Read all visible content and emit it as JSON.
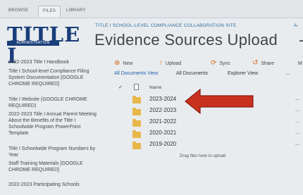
{
  "ribbon": {
    "tabs": [
      "BROWSE",
      "FILES",
      "LIBRARY"
    ]
  },
  "logo": {
    "text": "TITLE I",
    "subtext": "ADMINISTRATION"
  },
  "site": {
    "title": "TITLE I SCHOOL-LEVEL COMPLIANCE COLLABORATION SITE",
    "title_extra": "A-"
  },
  "page": {
    "title": "Evidence Sources Upload",
    "title_extra": "-"
  },
  "nav": {
    "items": [
      "2022-2023 Title I Handbook",
      "Title I School-level Compliance Filing System Documentation [GOOGLE CHROME REQUIRED]",
      "Title I Website (GOOGLE CHROME REQUIRED)",
      "2022-2023 Title I Annual Parent Meeting About the Benefits of the Title I Schoolwide Program PowerPoint Template",
      "Title I Schoolwide Program Numbers by Year",
      "Staff Training Materials [GOOGLE CHROME REQUIRED]",
      "2022-2023 Participating Schools"
    ]
  },
  "commands": {
    "new_label": "New",
    "upload_label": "Upload",
    "sync_label": "Sync",
    "share_label": "Share",
    "extra_label": "M"
  },
  "views": {
    "all_docs_view": "All Documents View",
    "all_docs": "All Documents",
    "explorer_view": "Explorer View",
    "more": "..."
  },
  "list": {
    "header_name": "Name",
    "folders": [
      "2023-2024",
      "2022-2023",
      "2021-2022",
      "2020-2021",
      "2019-2020"
    ],
    "row_menu": "...",
    "drag_hint": "Drag files here to upload"
  },
  "colors": {
    "accent": "#2d6b9a",
    "arrow": "#c9311f",
    "folder": "#e8b74a"
  }
}
